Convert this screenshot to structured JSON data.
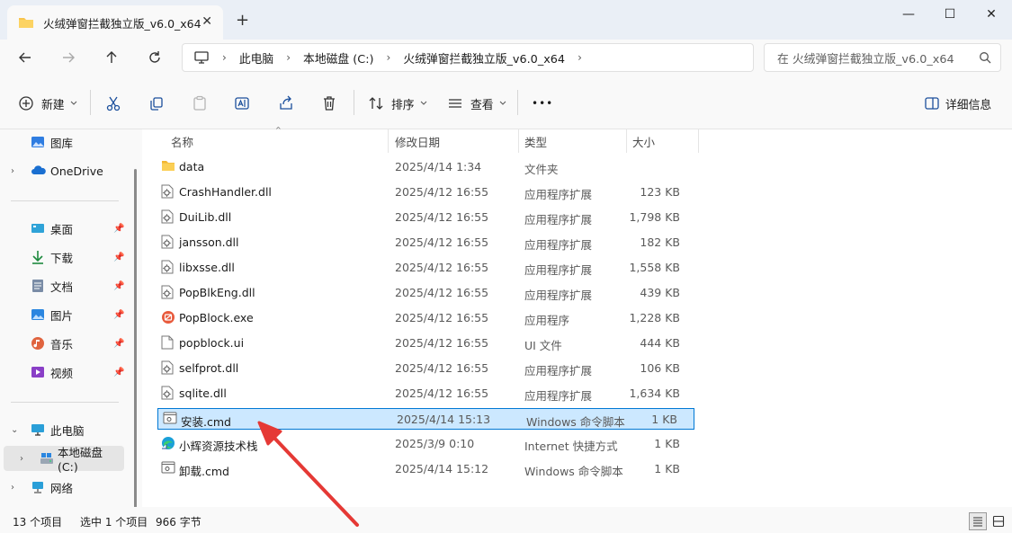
{
  "window": {
    "tab_title": "火绒弹窗拦截独立版_v6.0_x64",
    "new_tab": "+",
    "minimize": "—",
    "maximize": "☐",
    "close": "✕"
  },
  "address": {
    "crumbs": [
      "此电脑",
      "本地磁盘 (C:)",
      "火绒弹窗拦截独立版_v6.0_x64"
    ],
    "search_placeholder": "在 火绒弹窗拦截独立版_v6.0_x64"
  },
  "toolbar": {
    "new_label": "新建",
    "sort_label": "排序",
    "view_label": "查看",
    "more_label": "•••",
    "details_label": "详细信息"
  },
  "sidebar": {
    "items": [
      {
        "label": "图库",
        "icon": "gallery-icon"
      },
      {
        "label": "OneDrive",
        "icon": "cloud-icon"
      },
      {
        "label": "桌面",
        "icon": "desktop-icon"
      },
      {
        "label": "下载",
        "icon": "download-icon"
      },
      {
        "label": "文档",
        "icon": "document-icon"
      },
      {
        "label": "图片",
        "icon": "picture-icon"
      },
      {
        "label": "音乐",
        "icon": "music-icon"
      },
      {
        "label": "视频",
        "icon": "video-icon"
      },
      {
        "label": "此电脑",
        "icon": "computer-icon"
      },
      {
        "label": "本地磁盘 (C:)",
        "icon": "drive-icon"
      },
      {
        "label": "网络",
        "icon": "network-icon"
      }
    ]
  },
  "columns": {
    "name": "名称",
    "date": "修改日期",
    "type": "类型",
    "size": "大小"
  },
  "files": [
    {
      "name": "data",
      "date": "2025/4/14 1:34",
      "type": "文件夹",
      "size": "",
      "icon": "folder-icon"
    },
    {
      "name": "CrashHandler.dll",
      "date": "2025/4/12 16:55",
      "type": "应用程序扩展",
      "size": "123 KB",
      "icon": "dll-file-icon"
    },
    {
      "name": "DuiLib.dll",
      "date": "2025/4/12 16:55",
      "type": "应用程序扩展",
      "size": "1,798 KB",
      "icon": "dll-file-icon"
    },
    {
      "name": "jansson.dll",
      "date": "2025/4/12 16:55",
      "type": "应用程序扩展",
      "size": "182 KB",
      "icon": "dll-file-icon"
    },
    {
      "name": "libxsse.dll",
      "date": "2025/4/12 16:55",
      "type": "应用程序扩展",
      "size": "1,558 KB",
      "icon": "dll-file-icon"
    },
    {
      "name": "PopBlkEng.dll",
      "date": "2025/4/12 16:55",
      "type": "应用程序扩展",
      "size": "439 KB",
      "icon": "dll-file-icon"
    },
    {
      "name": "PopBlock.exe",
      "date": "2025/4/12 16:55",
      "type": "应用程序",
      "size": "1,228 KB",
      "icon": "exe-file-icon"
    },
    {
      "name": "popblock.ui",
      "date": "2025/4/12 16:55",
      "type": "UI 文件",
      "size": "444 KB",
      "icon": "blank-file-icon"
    },
    {
      "name": "selfprot.dll",
      "date": "2025/4/12 16:55",
      "type": "应用程序扩展",
      "size": "106 KB",
      "icon": "dll-file-icon"
    },
    {
      "name": "sqlite.dll",
      "date": "2025/4/12 16:55",
      "type": "应用程序扩展",
      "size": "1,634 KB",
      "icon": "dll-file-icon"
    },
    {
      "name": "安装.cmd",
      "date": "2025/4/14 15:13",
      "type": "Windows 命令脚本",
      "size": "1 KB",
      "icon": "cmd-file-icon"
    },
    {
      "name": "小辉资源技术栈",
      "date": "2025/3/9 0:10",
      "type": "Internet 快捷方式",
      "size": "1 KB",
      "icon": "edge-shortcut-icon"
    },
    {
      "name": "卸载.cmd",
      "date": "2025/4/14 15:12",
      "type": "Windows 命令脚本",
      "size": "1 KB",
      "icon": "cmd-file-icon"
    }
  ],
  "selected_index": 10,
  "status": {
    "count": "13 个项目",
    "selection": "选中 1 个项目",
    "size": "966 字节"
  },
  "colors": {
    "accent": "#0078d4",
    "selection": "#cce8ff",
    "arrow": "#e53935"
  }
}
